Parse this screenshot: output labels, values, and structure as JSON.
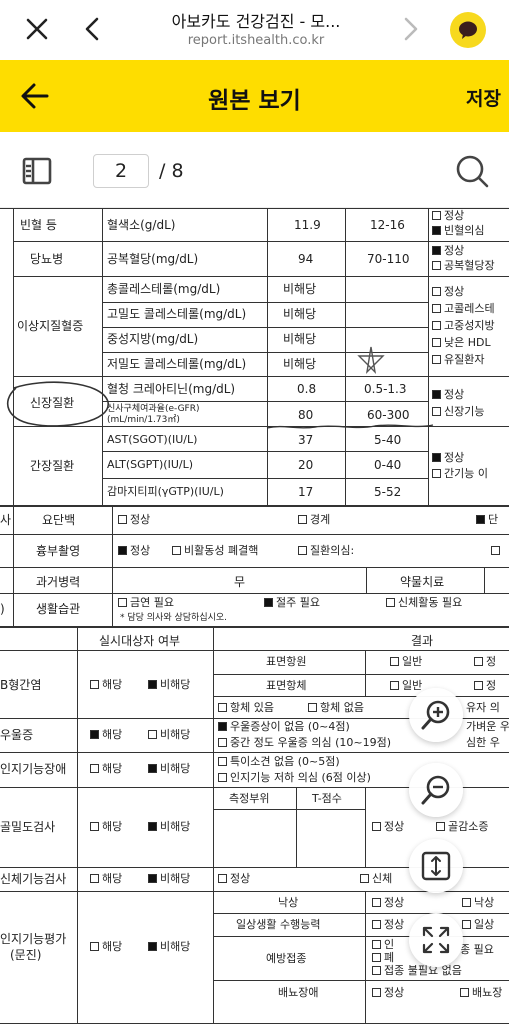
{
  "browser": {
    "title": "아보카도 건강검진 - 모...",
    "url": "report.itshealth.co.kr"
  },
  "header": {
    "title": "원본 보기",
    "save_label": "저장"
  },
  "pager": {
    "current_page": "2",
    "total_label": "/ 8"
  },
  "doc": {
    "rows_top": [
      {
        "cat": "빈혈 등",
        "item": "혈색소(g/dL)",
        "value": "11.9",
        "ref": "12-16",
        "opts": [
          "■ 정상",
          "■ 빈혈의심"
        ]
      },
      {
        "cat": "당뇨병",
        "item": "공복혈당(mg/dL)",
        "value": "94",
        "ref": "70-110",
        "opts": [
          "■ 정상",
          "■ 공복혈당장"
        ]
      }
    ],
    "lipid": {
      "cat": "이상지질혈증",
      "items": [
        {
          "item": "총콜레스테롤(mg/dL)",
          "value": "비해당"
        },
        {
          "item": "고밀도 콜레스테롤(mg/dL)",
          "value": "비해당"
        },
        {
          "item": "중성지방(mg/dL)",
          "value": "비해당"
        },
        {
          "item": "저밀도 콜레스테롤(mg/dL)",
          "value": "비해당"
        }
      ],
      "opts": [
        "정상",
        "고콜레스테",
        "고중성지방",
        "낮은 HDL",
        "유질환자"
      ]
    },
    "kidney": {
      "cat": "신장질환",
      "items": [
        {
          "item": "혈청 크레아티닌(mg/dL)",
          "value": "0.8",
          "ref": "0.5-1.3"
        },
        {
          "item": "신사구체여과율(e-GFR)",
          "item2": "(mL/min/1.73㎡)",
          "value": "80",
          "ref": "60-300"
        }
      ],
      "opts": [
        "정상",
        "신장기능"
      ]
    },
    "liver": {
      "cat": "간장질환",
      "items": [
        {
          "item": "AST(SGOT)(IU/L)",
          "value": "37",
          "ref": "5-40"
        },
        {
          "item": "ALT(SGPT)(IU/L)",
          "value": "20",
          "ref": "0-40"
        },
        {
          "item": "감마지티피(γGTP)(IU/L)",
          "value": "17",
          "ref": "5-52"
        }
      ],
      "opts": [
        "정상",
        "간기능 이"
      ]
    },
    "urine": {
      "left": "사",
      "label": "요단백",
      "opts": [
        "정상",
        "경계",
        "단"
      ]
    },
    "xray": {
      "label": "흉부촬영",
      "opts": [
        "정상",
        "비활동성 폐결핵",
        "질환의심:"
      ]
    },
    "history": {
      "label": "과거병력",
      "value": "무",
      "med_label": "약물치료"
    },
    "lifestyle": {
      "left": ")",
      "label": "생활습관",
      "opts": [
        "금연 필요",
        "절주 필요",
        "신체활동 필요"
      ],
      "note": "* 담당 의사와 상담하십시오."
    },
    "lower": {
      "col_target": "실시대상자 여부",
      "col_result": "결과",
      "rows": [
        {
          "label": "B형간염",
          "yes": "해당",
          "no": "비해당",
          "sub": [
            {
              "name": "표면항원",
              "opts": [
                "일반",
                "정"
              ]
            },
            {
              "name": "표면항체",
              "opts": [
                "일반",
                "정"
              ]
            },
            {
              "name": "",
              "opts": [
                "항체 있음",
                "항체 없음",
                "유자 의"
              ]
            }
          ]
        },
        {
          "label": "우울증",
          "yes": "해당",
          "no": "비해당",
          "lines": [
            "우울증상이 없음 (0~4점)",
            "중간 정도 우울증 의심 (10~19점)",
            "가벼운 우",
            "심한 우"
          ]
        },
        {
          "label": "인지기능장애",
          "yes": "해당",
          "no": "비해당",
          "lines": [
            "특이소견 없음 (0~5점)",
            "인지기능 저하 의심 (6점 이상)"
          ]
        },
        {
          "label": "골밀도검사",
          "yes": "해당",
          "no": "비해당",
          "cols": [
            "측정부위",
            "T-점수"
          ],
          "opts": [
            "정상",
            "골감소증"
          ]
        },
        {
          "label": "신체기능검사",
          "yes": "해당",
          "no": "비해당",
          "opts": [
            "정상",
            "신체"
          ]
        },
        {
          "label": "인지기능평가",
          "label2": "(문진)",
          "yes": "해당",
          "no": "비해당",
          "sub": [
            {
              "name": "낙상",
              "opts": [
                "정상",
                "낙상"
              ]
            },
            {
              "name": "일상생활 수행능력",
              "opts": [
                "정상",
                "일상"
              ]
            },
            {
              "name": "예방접종",
              "opts": [
                "인",
                "폐",
                "접종 불필요 없음",
                "종 필요"
              ]
            },
            {
              "name": "배뇨장애",
              "opts": [
                "정상",
                "배뇨장"
              ]
            }
          ]
        }
      ]
    }
  },
  "fabs": [
    "zoom-in",
    "zoom-out",
    "fit-page",
    "fullscreen"
  ]
}
